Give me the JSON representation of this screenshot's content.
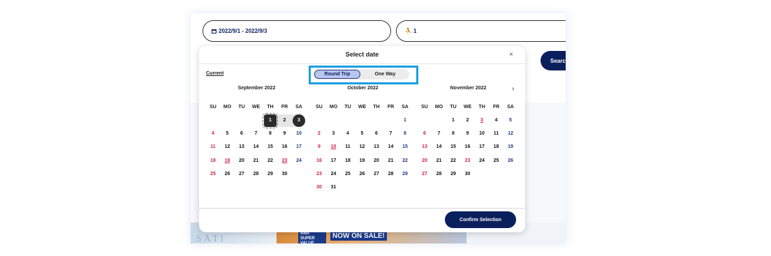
{
  "search_form": {
    "date_value": "2022/9/1 - 2022/9/3",
    "passenger_value": "1",
    "search_label": "Search"
  },
  "banner": {
    "faint_text": "S   A  T  l",
    "tag_text": "ANA SUPER VALUE",
    "sale_text": "NOW ON SALE!"
  },
  "modal": {
    "title": "Select date",
    "close": "×",
    "current_label": "Current",
    "trip_types": [
      "Round Trip",
      "One Way"
    ],
    "selected_trip_type": "Round Trip",
    "next_arrow": "›",
    "confirm_label": "Confirm Selection",
    "weekdays": [
      "SU",
      "MO",
      "TU",
      "WE",
      "TH",
      "FR",
      "SA"
    ],
    "months": [
      {
        "title": "September 2022",
        "first_weekday": 4,
        "days": 30,
        "red": [
          4,
          11,
          18,
          19,
          23,
          25
        ],
        "underline": [
          19,
          23
        ]
      },
      {
        "title": "October 2022",
        "first_weekday": 6,
        "days": 31,
        "red": [
          2,
          9,
          10,
          16,
          23,
          30
        ],
        "underline": [
          10
        ]
      },
      {
        "title": "November 2022",
        "first_weekday": 2,
        "days": 30,
        "red": [
          3,
          6,
          13,
          20,
          23,
          27
        ],
        "underline": [
          3
        ]
      }
    ],
    "selection": {
      "start": 1,
      "end": 3,
      "month_index": 0
    },
    "colors": {
      "accent": "#0b1f5c",
      "sunday_holiday": "#d0224a",
      "saturday": "#1b3a8a",
      "highlight": "#1aa0e0"
    }
  }
}
